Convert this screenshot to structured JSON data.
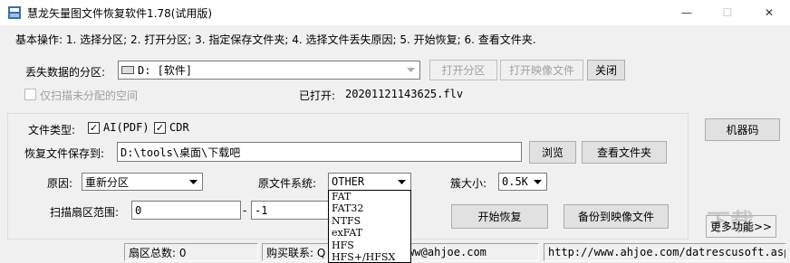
{
  "window": {
    "title": "慧龙矢量图文件恢复软件1.78(试用版)",
    "min": "—",
    "max": "☐",
    "close": "✕"
  },
  "steps_text": "基本操作: 1. 选择分区; 2. 打开分区; 3. 指定保存文件夹; 4. 选择文件丢失原因; 5. 开始恢复; 6. 查看文件夹.",
  "partition": {
    "label": "丢失数据的分区:",
    "selected": "D:  [软件]",
    "open_btn": "打开分区",
    "open_image_btn": "打开映像文件",
    "close_btn": "关闭",
    "unallocated_label": "仅扫描未分配的空间",
    "unallocated_checked": false,
    "opened_label": "已打开:",
    "opened_value": "20201121143625.flv"
  },
  "machine_code_btn": "机器码",
  "filetype": {
    "label": "文件类型:",
    "options": [
      {
        "label": "AI(PDF)",
        "checked": true
      },
      {
        "label": "CDR",
        "checked": true
      }
    ]
  },
  "save": {
    "label": "恢复文件保存到:",
    "value": "D:\\tools\\桌面\\下载吧",
    "browse_btn": "浏览",
    "view_folder_btn": "查看文件夹"
  },
  "reason": {
    "label": "原因:",
    "value": "重新分区"
  },
  "fs": {
    "label": "原文件系统:",
    "value": "OTHER",
    "options": [
      "FAT",
      "FAT32",
      "NTFS",
      "exFAT",
      "HFS",
      "HFS+/HFSX"
    ]
  },
  "cluster": {
    "label": "簇大小:",
    "value": "0.5K"
  },
  "scan_range": {
    "label": "扫描扇区范围:",
    "from": "0",
    "sep": "-",
    "to": "-1"
  },
  "start_btn": "开始恢复",
  "backup_btn": "备份到映像文件",
  "more_btn": "更多功能>>",
  "status": {
    "sectors": "扇区总数:  0",
    "buy": "购买联系: Q",
    "email": "SN www@ahjoe.com",
    "url": "http://www.ahjoe.com/datrescusoft.asp"
  },
  "watermark": "下载"
}
